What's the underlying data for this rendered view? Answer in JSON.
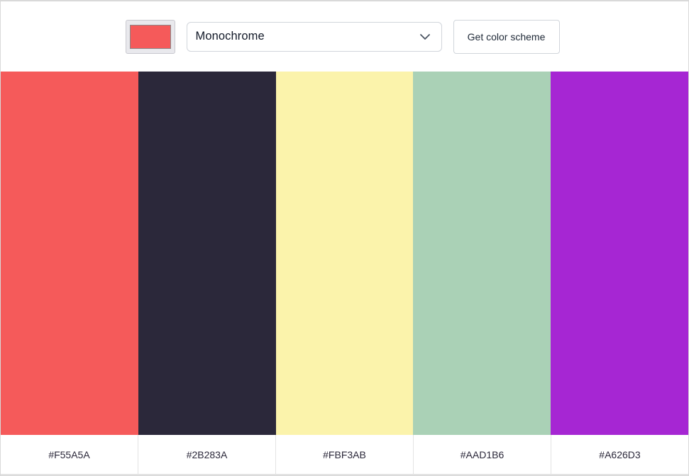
{
  "controls": {
    "seed_color": "#F55A5A",
    "mode_select": {
      "selected": "Monochrome",
      "icon": "chevron-down-icon"
    },
    "get_button_label": "Get color scheme"
  },
  "scheme": {
    "colors": [
      {
        "hex": "#F55A5A",
        "label": "#F55A5A"
      },
      {
        "hex": "#2B283A",
        "label": "#2B283A"
      },
      {
        "hex": "#FBF3AB",
        "label": "#FBF3AB"
      },
      {
        "hex": "#AAD1B6",
        "label": "#AAD1B6"
      },
      {
        "hex": "#A626D3",
        "label": "#A626D3"
      }
    ]
  }
}
